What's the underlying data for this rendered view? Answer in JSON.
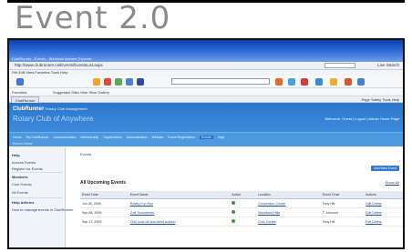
{
  "slide": {
    "title": "Event 2.0"
  },
  "browser": {
    "window_title": "ClubRunner - Events - Windows Internet Explorer",
    "address": "http://www.clubrunner.ca/Events/EventsList.aspx",
    "search_label": "Live Search",
    "menu": "File  Edit  View  Favorites  Tools  Help",
    "links_label": "Favorites",
    "links_items": "Suggested Sites  Web Slice Gallery",
    "tab_label": "ClubRunner",
    "tab_tools": "Page  Safety  Tools  Help"
  },
  "site": {
    "brand": "ClubRunner",
    "brand_tagline": "Rotary Club Management",
    "club_name": "Rotary Club of Anywhere",
    "welcome": "Welcome, Guest | Logout | Admin Home Page",
    "nav": [
      "Home",
      "My ClubRunner",
      "Communication",
      "Membership",
      "Organization",
      "Administration",
      "Website",
      "Event Registration",
      "Events",
      "Help"
    ],
    "nav_active": "Events",
    "subnav": "Events Home"
  },
  "sidebar": {
    "items": [
      {
        "label": "Help",
        "heading": true
      },
      {
        "label": "Access Events",
        "heading": false
      },
      {
        "label": "Register for Events",
        "heading": false
      },
      {
        "label": "Members",
        "heading": true
      },
      {
        "label": "Club Events",
        "heading": false
      },
      {
        "label": "All Events",
        "heading": false
      },
      {
        "label": "Help Articles",
        "heading": true
      },
      {
        "label": "How to manage events in ClubRunner",
        "heading": false
      }
    ]
  },
  "main": {
    "breadcrumb": "Events",
    "add_button": "Add New Event",
    "show_link": "Show All",
    "heading": "All Upcoming Events",
    "columns": [
      "Event Date",
      "Event Name",
      "Active",
      "Location",
      "Event Chair",
      "Actions"
    ],
    "rows": [
      {
        "date": "Jun 05, 2009",
        "name": "Rotary Fun Run",
        "location": "Convention Centre",
        "chair": "Tony Hill",
        "actions": "Edit  Delete"
      },
      {
        "date": "Sep 08, 2009",
        "name": "Golf Tournament",
        "location": "Woodland Hills",
        "chair": "T. Johnson",
        "actions": "Edit  Delete"
      },
      {
        "date": "Sep 17, 2009",
        "name": "Chili cook-off and silent auction",
        "location": "Civic Centre",
        "chair": "Tony Hill",
        "actions": "Edit  Delete"
      }
    ]
  },
  "colors": {
    "titlebar": "#0b3fa8",
    "site_header": "#2c77cc",
    "site_nav": "#4d9ae0",
    "active_dot": "#3b9a2e"
  }
}
